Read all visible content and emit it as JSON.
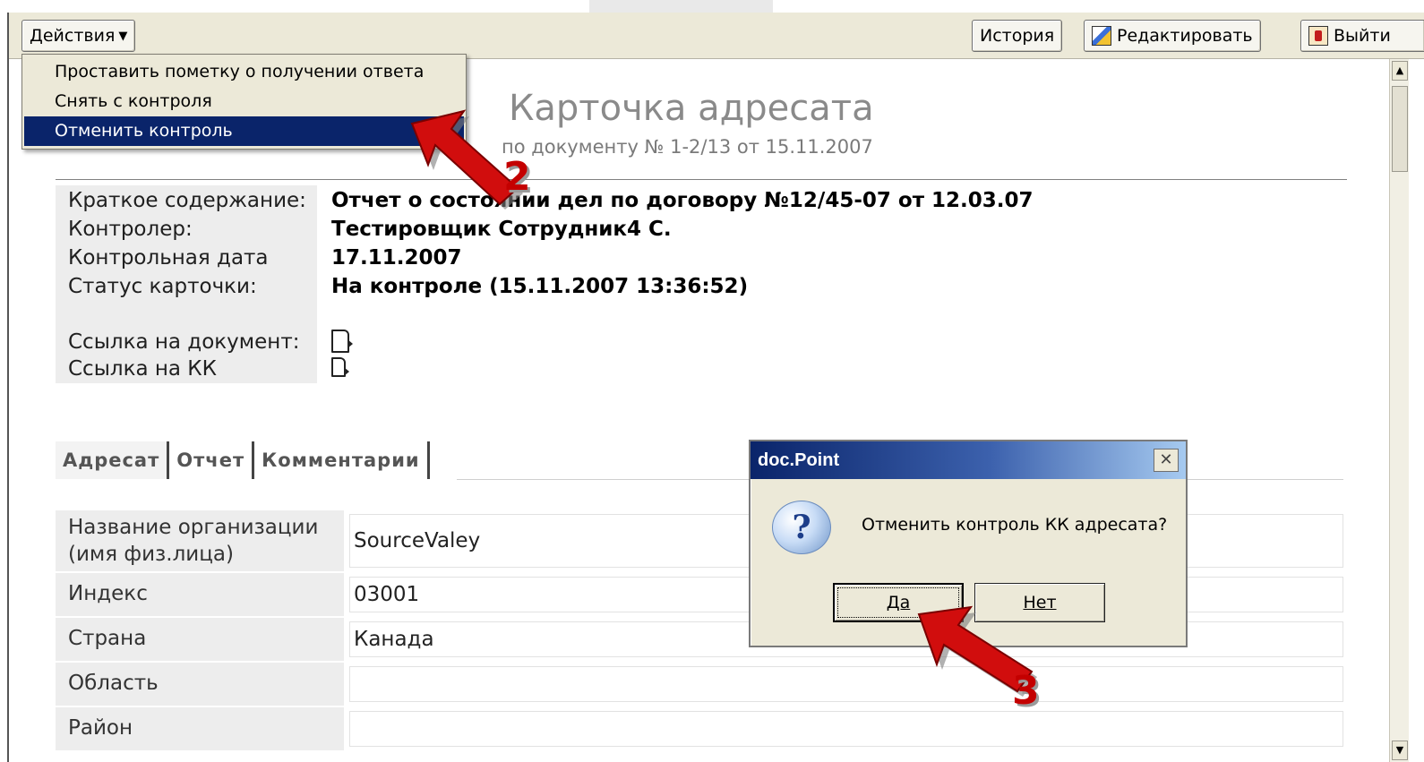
{
  "toolbar": {
    "actions_label": "Действия",
    "history_label": "История",
    "edit_label": "Редактировать",
    "exit_label": "Выйти"
  },
  "menu": {
    "items": [
      "Проставить пометку о получении ответа",
      "Снять с контроля",
      "Отменить контроль"
    ],
    "selected_index": 2
  },
  "card": {
    "title": "Карточка адресата",
    "subtitle": "по документу № 1-2/13 от 15.11.2007"
  },
  "info": {
    "summary_label": "Краткое содержание:",
    "summary_value": "Отчет о состоянии дел по договору №12/45-07 от 12.03.07",
    "controller_label": "Контролер:",
    "controller_value": "Тестировщик Сотрудник4 С.",
    "control_date_label": "Контрольная дата",
    "control_date_value": "17.11.2007",
    "status_label": "Статус карточки:",
    "status_value": "На контроле (15.11.2007 13:36:52)",
    "doc_link_label": "Ссылка на документ:",
    "kk_link_label": "Ссылка на КК"
  },
  "tabs": [
    {
      "label": "Адресат",
      "active": true
    },
    {
      "label": "Отчет",
      "active": false
    },
    {
      "label": "Комментарии",
      "active": false
    }
  ],
  "address": {
    "rows": [
      {
        "label": "Название организации (имя физ.лица)",
        "value": "SourceValey"
      },
      {
        "label": "Индекс",
        "value": "03001"
      },
      {
        "label": "Страна",
        "value": "Канада"
      },
      {
        "label": "Область",
        "value": ""
      },
      {
        "label": "Район",
        "value": ""
      }
    ]
  },
  "dialog": {
    "title": "doc.Point",
    "close_glyph": "✕",
    "icon_glyph": "?",
    "message": "Отменить контроль КК адресата?",
    "yes_label": "Да",
    "no_label": "Нет"
  },
  "annotations": {
    "step2": "2",
    "step3": "3"
  },
  "colors": {
    "menu_selected": "#0a246a",
    "annotation_red": "#c40000",
    "title_bar": "#0a246a"
  }
}
